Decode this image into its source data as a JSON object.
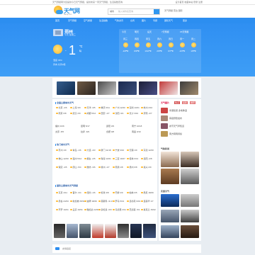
{
  "topbar": {
    "left_text": "天气预报网为您提供今日天气预报，提供未来一周天气预报，生活指数查询",
    "right_text": "设为首页  收藏本站  登录  注册"
  },
  "header": {
    "logo_name": "天气网",
    "logo_sub": "tianqi.com",
    "search_city": "城市",
    "search_placeholder": "输入城市名查询",
    "links": "天气预报  雷达  国际"
  },
  "nav": {
    "items": [
      "首页",
      "天气预报",
      "空气质量",
      "生活指数",
      "气象资讯",
      "台风",
      "图片",
      "专题",
      "国际天气",
      "更多"
    ]
  },
  "hero": {
    "city": "郑州",
    "city_sub": "今天 星期三",
    "temp_sign": "-",
    "temp": "1",
    "temp_unit": "℃",
    "temp_desc": "晴",
    "line1": "湿度 45%",
    "line2": "风向 北风2级",
    "button_label": "天气预报 7天",
    "extra1": "空气 良",
    "extra2": "更新",
    "forecast_tabs": [
      "今天",
      "明天",
      "后天",
      "7天预报",
      "15天预报"
    ],
    "forecast_days": [
      {
        "day": "周三",
        "temp": "-1/8℃"
      },
      {
        "day": "周四",
        "temp": "0/9℃"
      },
      {
        "day": "周五",
        "temp": "1/10℃"
      },
      {
        "day": "周六",
        "temp": "2/9℃"
      },
      {
        "day": "周日",
        "temp": "0/7℃"
      },
      {
        "day": "周一",
        "temp": "-1/6℃"
      },
      {
        "day": "周二",
        "temp": "1/8℃"
      }
    ]
  },
  "sections": {
    "sec1_title": "全国主要城市天气",
    "sec2_title": "热门城市天气",
    "sec3_title": "国际主要城市天气预报",
    "rows1": [
      [
        "北京 -2/6",
        "上海 3/9",
        "天津 -3/5",
        "重庆 6/11",
        "广州 12/20",
        "深圳 13/21",
        "杭州 2/10"
      ],
      [
        "南京 0/8",
        "武汉 2/9",
        "成都 5/12",
        "西安 -1/7",
        "沈阳 -9/1",
        "长沙 3/10",
        "济南 -2/7"
      ],
      [
        "福州 9/16",
        "昆明 5/17",
        "贵阳 3/9",
        "南宁 10/18",
        "海口 16/24",
        "兰州 -6/4",
        "银川 -7/3"
      ],
      [
        "太原 -5/5",
        "拉萨 -6/9",
        "合肥 0/8",
        "南昌 3/10",
        "郑州 -1/8",
        "石家庄 -3/6",
        "哈尔滨 -18/-8"
      ]
    ],
    "rows2": [
      [
        "苏州 1/9",
        "青岛 -1/6",
        "大连 -4/3",
        "厦门 11/18",
        "宁波 3/10",
        "无锡 1/9",
        "东莞 12/20"
      ],
      [
        "佛山 12/20",
        "温州 5/12",
        "烟台 -2/5",
        "珠海 13/21",
        "三亚 19/27",
        "桂林 6/13",
        "洛阳 -2/8"
      ],
      [
        "保定 -4/5",
        "唐山 -5/4",
        "潍坊 -3/6",
        "徐州 -1/7",
        "南通 1/8",
        "扬州 0/8",
        "嘉兴 2/9"
      ]
    ],
    "rows3": [
      [
        "东京 4/11",
        "首尔 -3/4",
        "纽约 -1/6",
        "伦敦 3/8",
        "巴黎 2/9",
        "柏林 0/5",
        "悉尼 18/26"
      ],
      [
        "曼谷 24/33",
        "新加坡 25/31",
        "迪拜 18/26",
        "莫斯科 -9/-3",
        "罗马 5/13",
        "洛杉矶 9/19",
        "温哥华 1/7"
      ],
      [
        "开罗 10/21",
        "孟买 19/31",
        "雅加达 24/31",
        "多伦多 -6/0",
        "马德里 2/11",
        "芝加哥 -5/1",
        "奥克兰 15/22"
      ]
    ]
  },
  "side": {
    "title1": "天气图片",
    "tabs": [
      "热点",
      "最新",
      "推荐"
    ],
    "title2": "气象新闻",
    "title3": "实景天气",
    "news": [
      "寒潮来袭 多地降温",
      "雾霾预警发布",
      "春节天气早知道",
      "南方阴雨持续"
    ]
  },
  "bottom": {
    "label": "友情链接"
  },
  "colors": {
    "brand": "#2c8ef0",
    "hero_top": "#2f8ff2",
    "sun": "#ffb82b",
    "green_button": "#5dbb36"
  }
}
